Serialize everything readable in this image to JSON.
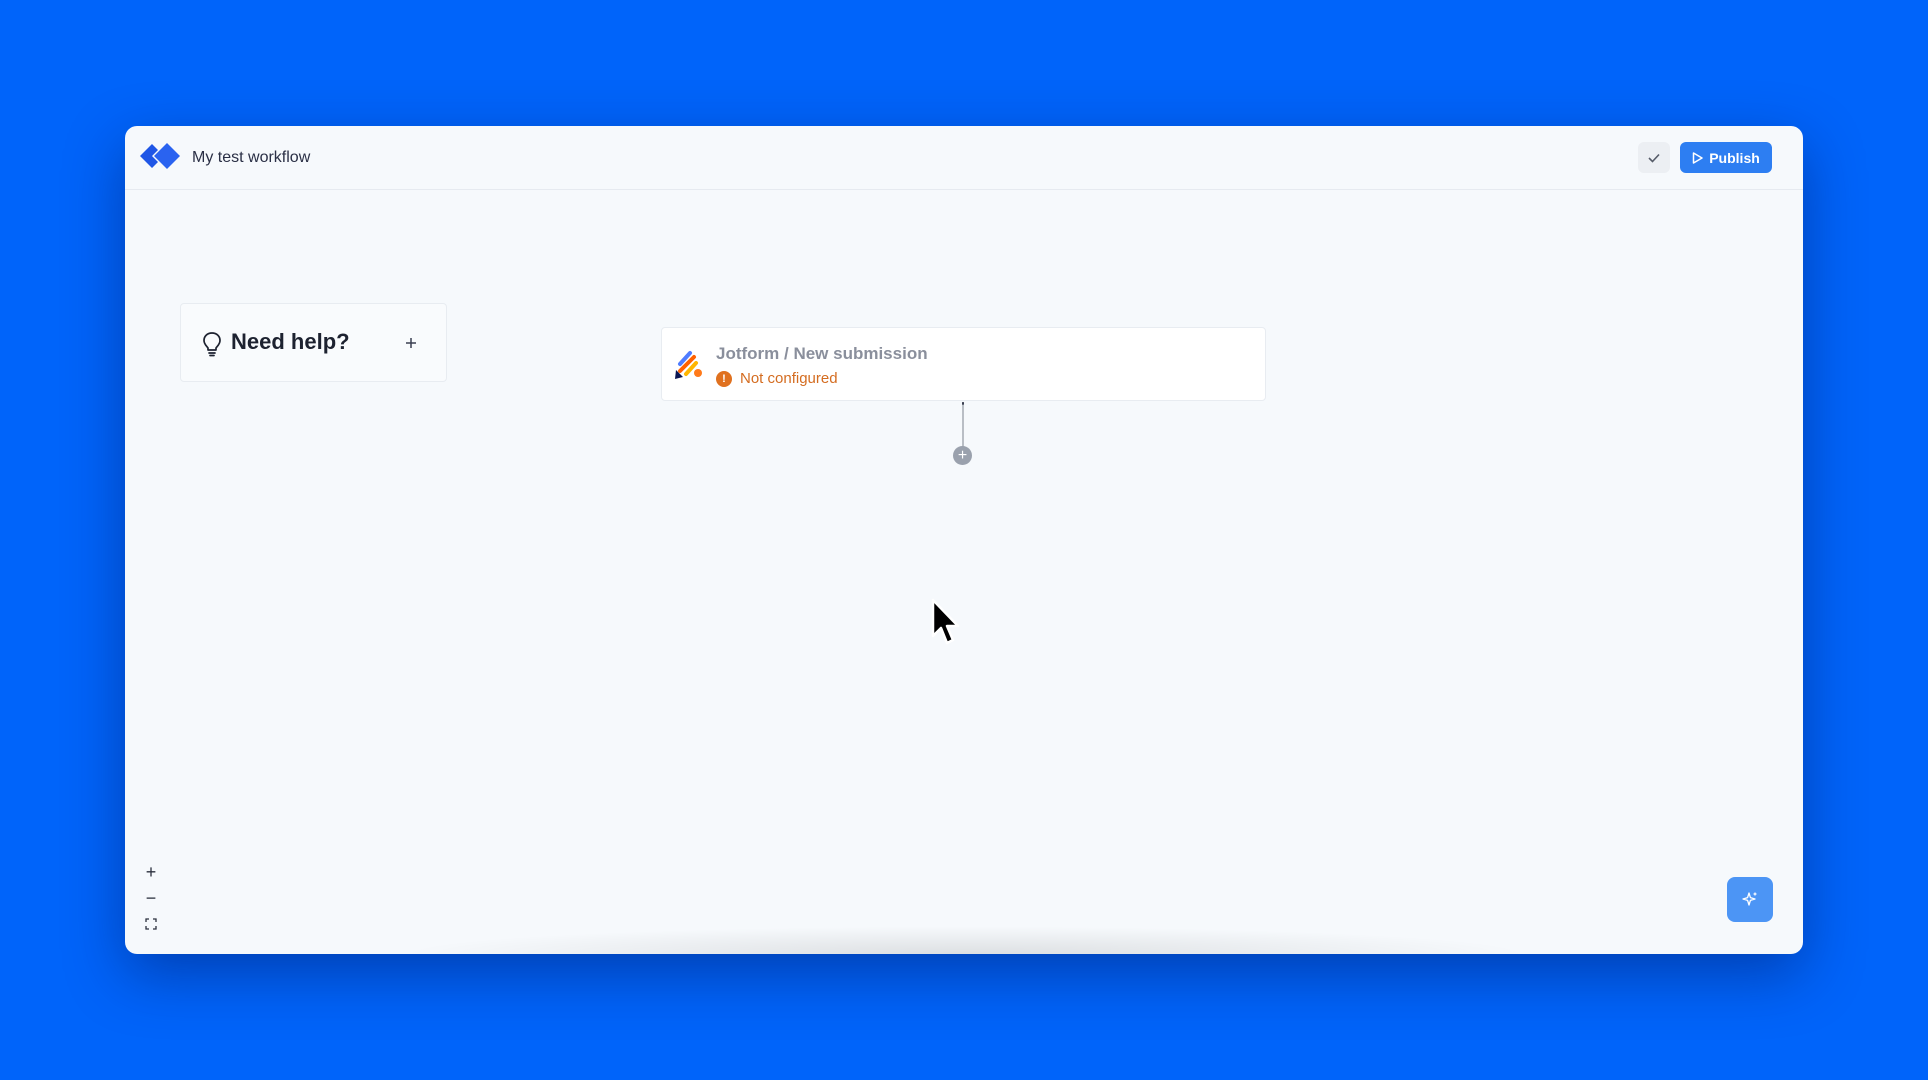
{
  "header": {
    "workflow_title": "My test workflow",
    "publish_label": "Publish"
  },
  "help_card": {
    "label": "Need help?"
  },
  "trigger_node": {
    "title": "Jotform / New submission",
    "status": "Not configured",
    "status_mark": "!"
  },
  "canvas": {
    "add_step_symbol": "+",
    "zoom_in_symbol": "+",
    "zoom_out_symbol": "−"
  },
  "colors": {
    "page_background": "#0064fa",
    "accent": "#2d7ef2",
    "warning": "#e0711f",
    "logo": "#1f56e6"
  },
  "icons": {
    "logo": "diamond-chevron-logo-icon",
    "check": "check-icon",
    "publish": "play-icon",
    "help": "lightbulb-icon",
    "trigger": "jotform-pencil-icon",
    "warning": "alert-circle-icon",
    "fit": "fit-view-icon",
    "ai": "sparkle-icon",
    "cursor": "mouse-pointer-icon"
  }
}
